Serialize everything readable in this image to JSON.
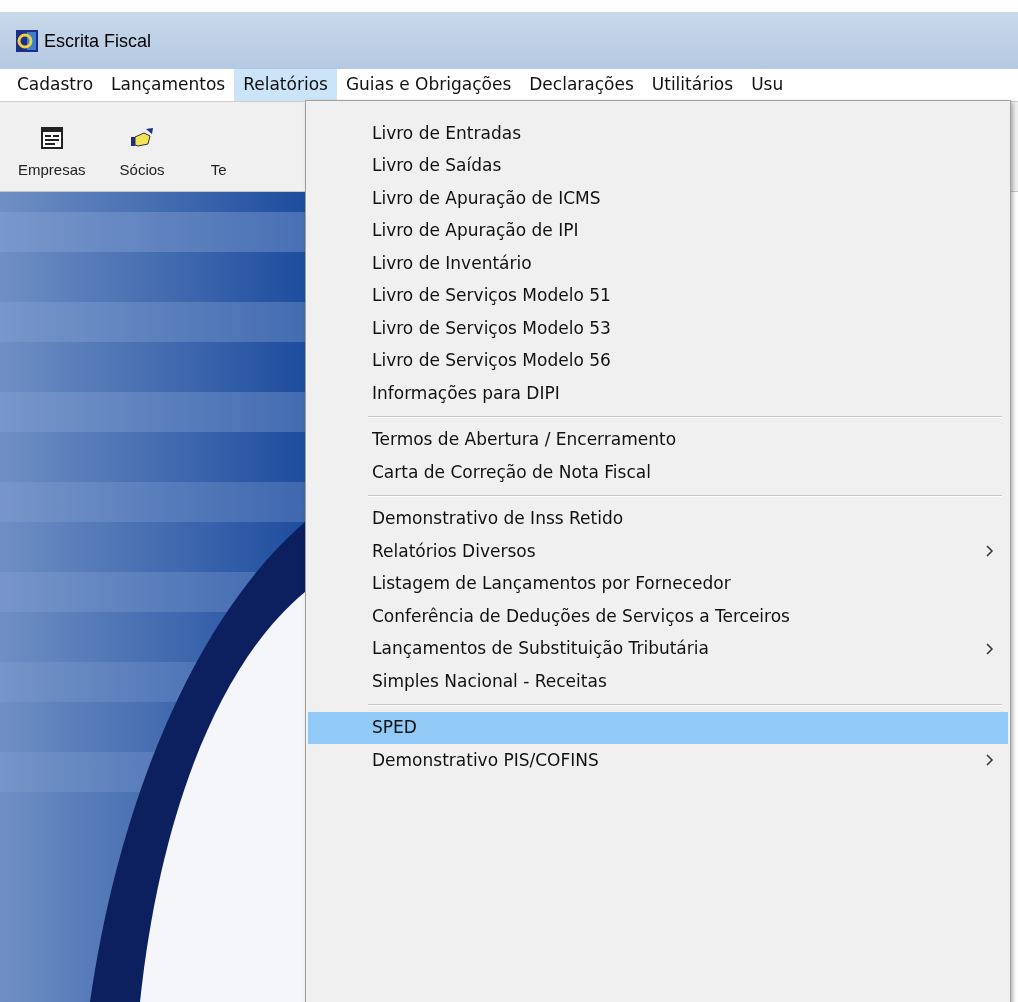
{
  "window": {
    "title": "Escrita Fiscal"
  },
  "menu_bar": [
    {
      "label": "Cadastro",
      "selected": false
    },
    {
      "label": "Lançamentos",
      "selected": false
    },
    {
      "label": "Relatórios",
      "selected": true
    },
    {
      "label": "Guias e Obrigações",
      "selected": false
    },
    {
      "label": "Declarações",
      "selected": false
    },
    {
      "label": "Utilitários",
      "selected": false
    },
    {
      "label": "Usu",
      "selected": false
    }
  ],
  "toolbar": [
    {
      "label": "Empresas",
      "kind": "form"
    },
    {
      "label": "Sócios",
      "kind": "hand"
    },
    {
      "label": "Te",
      "kind": "none"
    }
  ],
  "dropdown": [
    {
      "kind": "item",
      "label": "Livro de Entradas",
      "submenu": false,
      "selected": false
    },
    {
      "kind": "item",
      "label": "Livro de Saídas",
      "submenu": false,
      "selected": false
    },
    {
      "kind": "item",
      "label": "Livro de Apuração de ICMS",
      "submenu": false,
      "selected": false
    },
    {
      "kind": "item",
      "label": "Livro de Apuração de IPI",
      "submenu": false,
      "selected": false
    },
    {
      "kind": "item",
      "label": "Livro de Inventário",
      "submenu": false,
      "selected": false
    },
    {
      "kind": "item",
      "label": "Livro de Serviços Modelo 51",
      "submenu": false,
      "selected": false
    },
    {
      "kind": "item",
      "label": "Livro de Serviços Modelo 53",
      "submenu": false,
      "selected": false
    },
    {
      "kind": "item",
      "label": "Livro de Serviços Modelo 56",
      "submenu": false,
      "selected": false
    },
    {
      "kind": "item",
      "label": "Informações para DIPI",
      "submenu": false,
      "selected": false
    },
    {
      "kind": "separator"
    },
    {
      "kind": "item",
      "label": "Termos de Abertura / Encerramento",
      "submenu": false,
      "selected": false
    },
    {
      "kind": "item",
      "label": "Carta de Correção de Nota Fiscal",
      "submenu": false,
      "selected": false
    },
    {
      "kind": "separator"
    },
    {
      "kind": "item",
      "label": "Demonstrativo de Inss Retido",
      "submenu": false,
      "selected": false
    },
    {
      "kind": "item",
      "label": "Relatórios Diversos",
      "submenu": true,
      "selected": false
    },
    {
      "kind": "item",
      "label": "Listagem de Lançamentos por Fornecedor",
      "submenu": false,
      "selected": false
    },
    {
      "kind": "item",
      "label": "Conferência de Deduções de Serviços a Terceiros",
      "submenu": false,
      "selected": false
    },
    {
      "kind": "item",
      "label": "Lançamentos de Substituição Tributária",
      "submenu": true,
      "selected": false
    },
    {
      "kind": "item",
      "label": "Simples Nacional - Receitas",
      "submenu": false,
      "selected": false
    },
    {
      "kind": "separator"
    },
    {
      "kind": "item",
      "label": "SPED",
      "submenu": false,
      "selected": true
    },
    {
      "kind": "item",
      "label": "Demonstrativo PIS/COFINS",
      "submenu": true,
      "selected": false
    }
  ]
}
